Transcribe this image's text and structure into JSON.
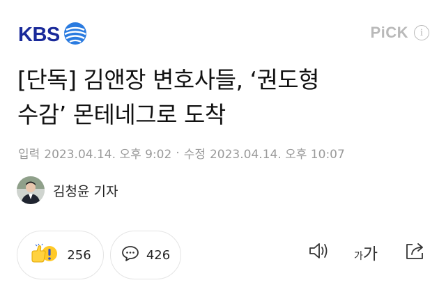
{
  "header": {
    "logo_text": "KBS",
    "pick_text": "PiCK",
    "info_label": "i"
  },
  "article": {
    "title_line1": "[단독] 김앤장 변호사들, ‘권도형",
    "title_line2": "수감’ 몬테네그로 도착",
    "published_label": "입력",
    "published": "2023.04.14. 오후 9:02",
    "separator": "·",
    "modified_label": "수정",
    "modified": "2023.04.14. 오후 10:07"
  },
  "reporter": {
    "name": "김청윤 기자"
  },
  "reactions": {
    "like_count": "256",
    "comment_count": "426"
  },
  "tools": {
    "font_small": "가",
    "font_big": "가"
  },
  "icons": [
    "kbs-logo-icon",
    "info-icon",
    "reaction-emoji-icon",
    "comment-bubble-icon",
    "speaker-icon",
    "font-size-icon",
    "share-icon"
  ],
  "colors": {
    "brand": "#1a2a9a",
    "brand_light": "#2a7be0",
    "muted": "#9a9a9a",
    "pick": "#b9b9b9"
  }
}
